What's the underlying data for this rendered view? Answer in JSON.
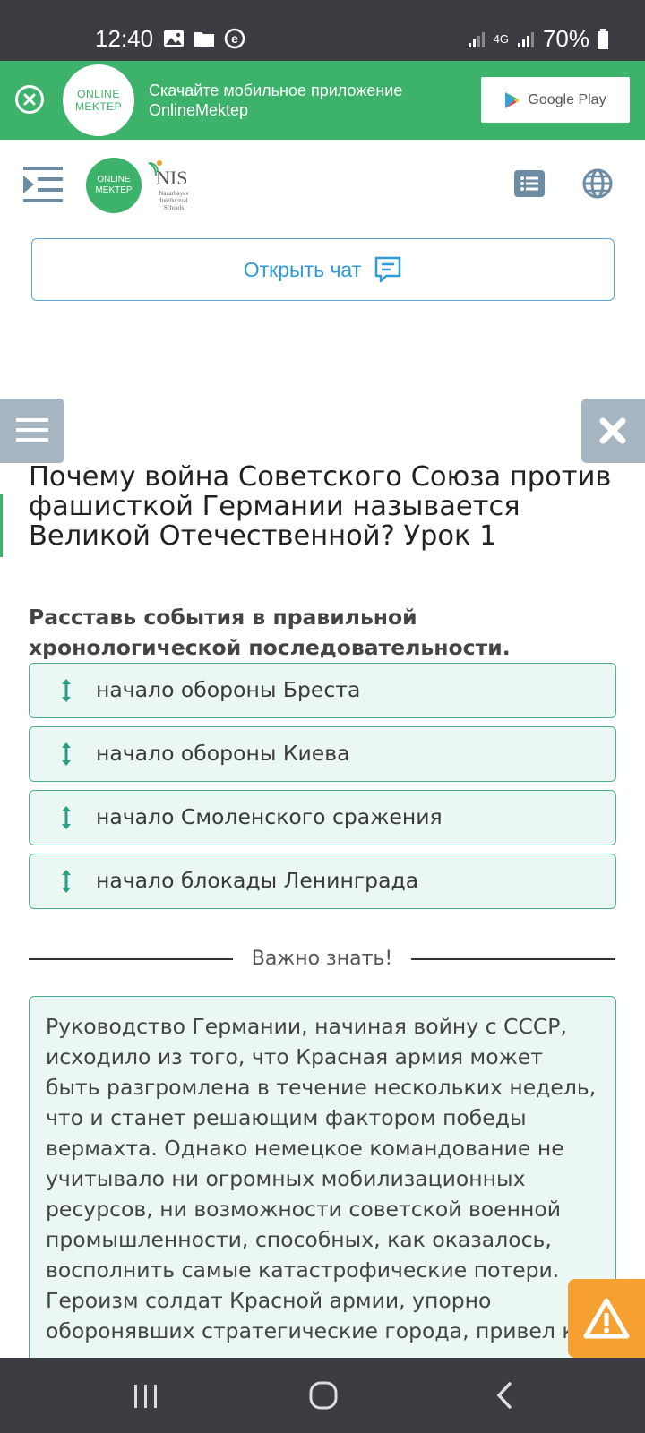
{
  "status_bar": {
    "time": "12:40",
    "network": "4G",
    "battery": "70%"
  },
  "app_banner": {
    "logo_line1": "ONLINE",
    "logo_line2": "MEKTEP",
    "text_line1": "Скачайте мобильное приложение",
    "text_line2": "OnlineMektep",
    "store_label": "Google Play"
  },
  "header": {
    "logo_line1": "ONLINE",
    "logo_line2": "MEKTEP",
    "nis_word": "NIS",
    "nis_sub": "Nazarbayev Intellectual Schools"
  },
  "chat_button": {
    "label": "Открыть чат"
  },
  "lesson": {
    "title": "Почему война Советского Союза против фашисткой Германии называется Великой Отечественной? Урок 1"
  },
  "task": {
    "instruction": "Расставь события в правильной хронологической последовательности.",
    "items": [
      {
        "label": "начало обороны Бреста"
      },
      {
        "label": "начало обороны Киева"
      },
      {
        "label": "начало Смоленского сражения"
      },
      {
        "label": "начало блокады Ленинграда"
      }
    ]
  },
  "important": {
    "heading": "Важно знать!",
    "text": "Руководство Германии, начиная войну с СССР, исходило из того, что Красная армия может быть разгромлена в течение нескольких недель, что и станет решающим фактором победы вермахта. Однако немецкое командование не учитывало ни огромных мобилизационных ресурсов, ни возможности советской военной промышленности, способных, как оказалось, восполнить самые катастрофические потери. Героизм солдат Красной армии, упорно оборонявших стратегические города, привел к"
  },
  "colors": {
    "brand_green": "#3cb26a",
    "item_border": "#48ad9a",
    "item_bg": "#eaf7f2",
    "chat_blue": "#2e9ad6",
    "warning": "#f5a030"
  }
}
